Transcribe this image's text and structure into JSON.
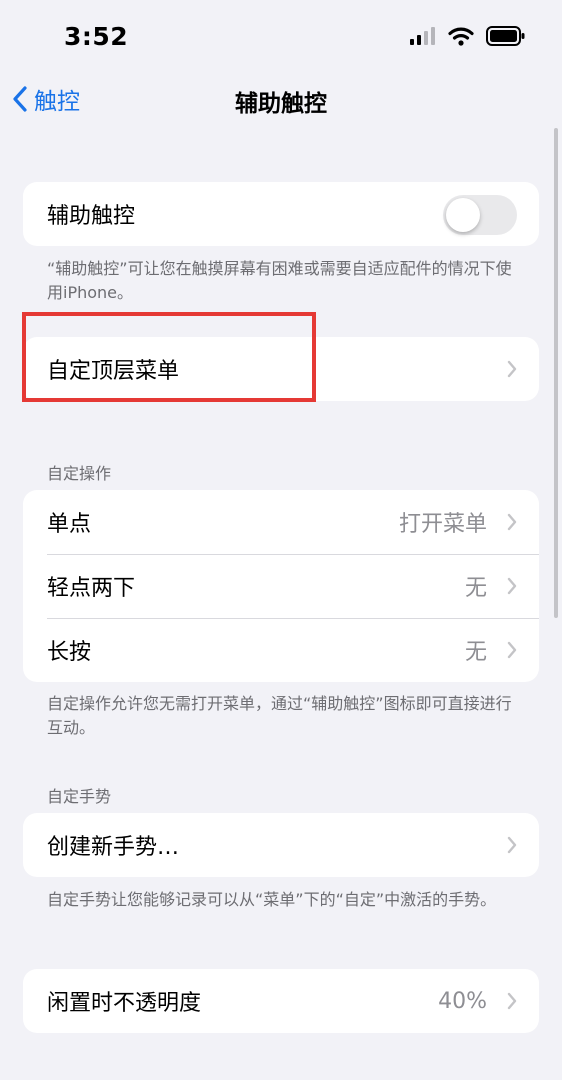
{
  "status_bar": {
    "time": "3:52",
    "icons": [
      "cellular-signal-icon",
      "wifi-icon",
      "battery-icon"
    ]
  },
  "nav": {
    "back_label": "触控",
    "title": "辅助触控"
  },
  "assistive_touch": {
    "label": "辅助触控",
    "enabled": false,
    "footnote": "“辅助触控”可让您在触摸屏幕有困难或需要自适应配件的情况下使用iPhone。"
  },
  "top_level_menu": {
    "label": "自定顶层菜单"
  },
  "custom_actions": {
    "header": "自定操作",
    "rows": [
      {
        "label": "单点",
        "value": "打开菜单"
      },
      {
        "label": "轻点两下",
        "value": "无"
      },
      {
        "label": "长按",
        "value": "无"
      }
    ],
    "footnote": "自定操作允许您无需打开菜单，通过“辅助触控”图标即可直接进行互动。"
  },
  "custom_gestures": {
    "header": "自定手势",
    "create_label": "创建新手势…",
    "footnote": "自定手势让您能够记录可以从“菜单”下的“自定”中激活的手势。"
  },
  "idle_opacity": {
    "label": "闲置时不透明度",
    "value": "40%"
  },
  "colors": {
    "accent": "#1a73e8",
    "background": "#f2f2f7",
    "highlight": "#e53935",
    "secondary_text": "#8e8e93"
  }
}
